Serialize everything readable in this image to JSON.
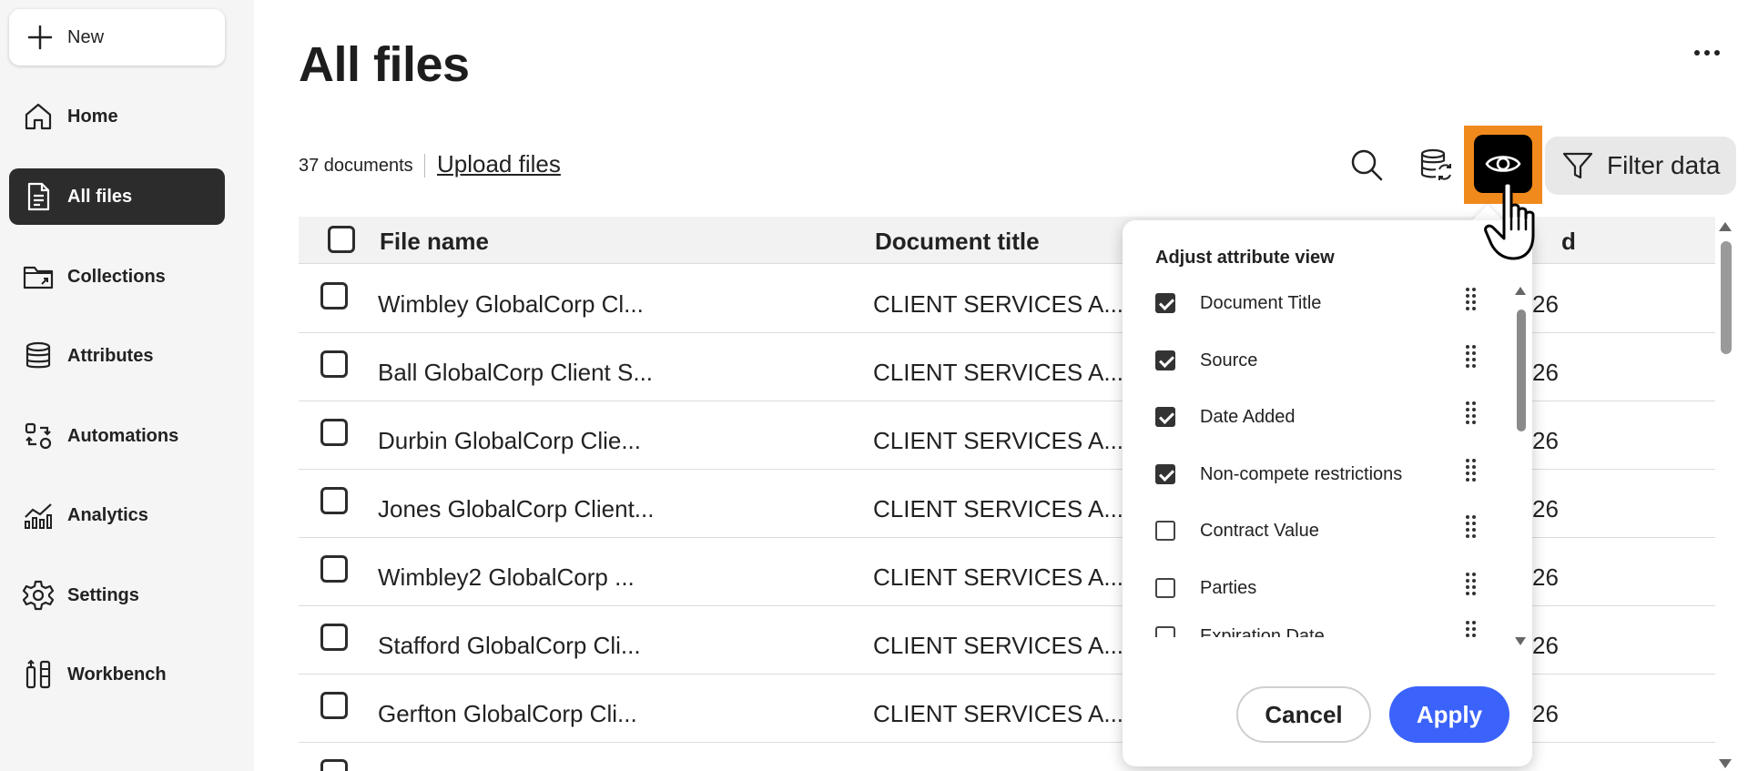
{
  "sidebar": {
    "new_label": "New",
    "items": [
      {
        "label": "Home",
        "icon": "home-icon"
      },
      {
        "label": "All files",
        "icon": "document-icon",
        "active": true
      },
      {
        "label": "Collections",
        "icon": "folder-icon"
      },
      {
        "label": "Attributes",
        "icon": "database-icon"
      },
      {
        "label": "Automations",
        "icon": "automation-icon"
      },
      {
        "label": "Analytics",
        "icon": "chart-icon"
      },
      {
        "label": "Settings",
        "icon": "gear-icon"
      },
      {
        "label": "Workbench",
        "icon": "workbench-icon"
      }
    ]
  },
  "main": {
    "title": "All files",
    "doc_count": "37 documents",
    "upload_label": "Upload files",
    "filter_label": "Filter data",
    "accent_color": "#f08a1c"
  },
  "table": {
    "columns": [
      "File name",
      "Document title",
      "d"
    ],
    "rows": [
      {
        "file_name": "Wimbley GlobalCorp Cl...",
        "doc_title": "CLIENT SERVICES A...",
        "date": "26"
      },
      {
        "file_name": "Ball GlobalCorp Client S...",
        "doc_title": "CLIENT SERVICES A...",
        "date": "26"
      },
      {
        "file_name": "Durbin GlobalCorp Clie...",
        "doc_title": "CLIENT SERVICES A...",
        "date": "26"
      },
      {
        "file_name": "Jones GlobalCorp Client...",
        "doc_title": "CLIENT SERVICES A...",
        "date": "26"
      },
      {
        "file_name": "Wimbley2 GlobalCorp ...",
        "doc_title": "CLIENT SERVICES A...",
        "date": "26"
      },
      {
        "file_name": "Stafford GlobalCorp Cli...",
        "doc_title": "CLIENT SERVICES A...",
        "date": "26"
      },
      {
        "file_name": "Gerfton GlobalCorp Cli...",
        "doc_title": "CLIENT SERVICES A...",
        "date": "26"
      }
    ]
  },
  "popover": {
    "title": "Adjust attribute view",
    "attributes": [
      {
        "label": "Document Title",
        "checked": true
      },
      {
        "label": "Source",
        "checked": true
      },
      {
        "label": "Date Added",
        "checked": true
      },
      {
        "label": "Non-compete restrictions",
        "checked": true
      },
      {
        "label": "Contract Value",
        "checked": false
      },
      {
        "label": "Parties",
        "checked": false
      },
      {
        "label": "Expiration Date",
        "checked": false
      }
    ],
    "cancel_label": "Cancel",
    "apply_label": "Apply",
    "apply_color": "#3b63fb"
  }
}
